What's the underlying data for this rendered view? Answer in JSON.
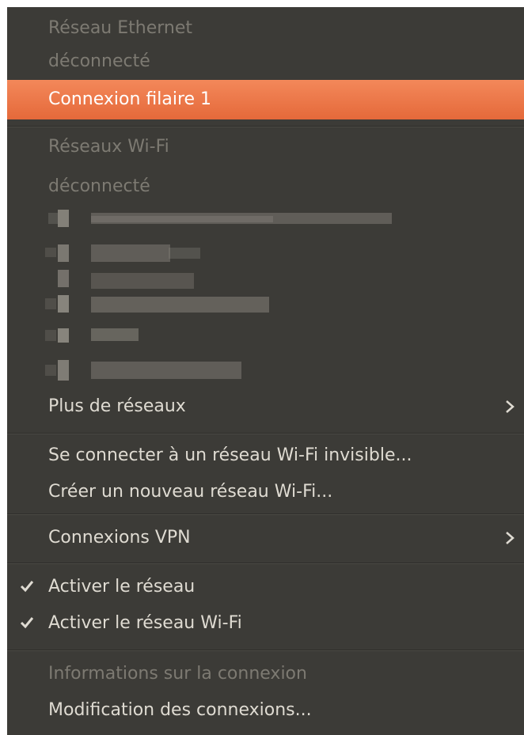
{
  "menu": {
    "ethernet_header": "Réseau Ethernet",
    "ethernet_status": "déconnecté",
    "wired_connection": "Connexion filaire 1",
    "wifi_header": "Réseaux Wi-Fi",
    "wifi_status": "déconnecté",
    "more_networks": "Plus de réseaux",
    "connect_hidden": "Se connecter à un réseau Wi-Fi invisible...",
    "create_network": "Créer un nouveau réseau Wi-Fi...",
    "vpn_connections": "Connexions VPN",
    "enable_networking": "Activer le réseau",
    "enable_wifi": "Activer le réseau Wi-Fi",
    "connection_info": "Informations sur la connexion",
    "edit_connections": "Modification des connexions..."
  },
  "colors": {
    "menu_bg": "#3c3b37",
    "highlight": "#e9723f",
    "text": "#dfdbd2",
    "disabled_text": "#7d7a72"
  },
  "icons": {
    "submenu": "chevron-right-icon",
    "checked": "check-icon"
  }
}
